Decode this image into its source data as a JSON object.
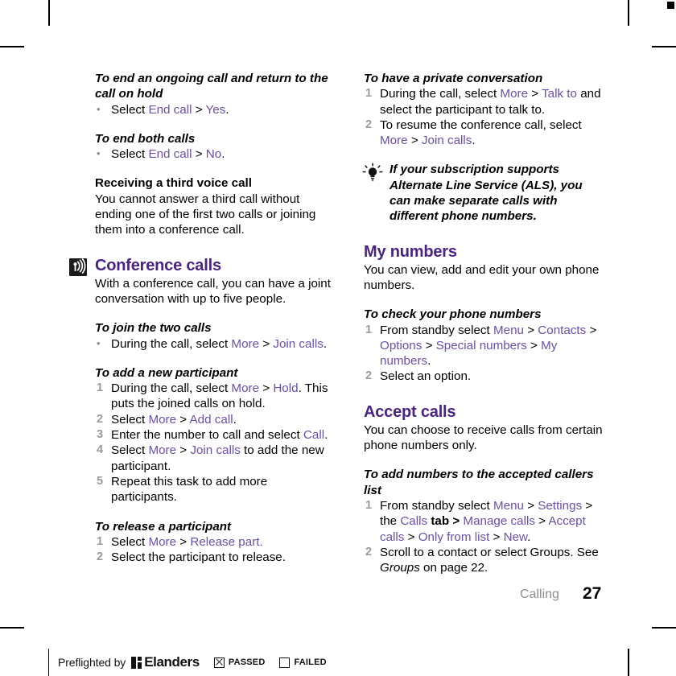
{
  "document": {
    "chapter": "Calling",
    "page_number": "27"
  },
  "left_column": {
    "block1": {
      "heading": "To end an ongoing call and return to the call on hold",
      "bullets": [
        {
          "pre": "Select ",
          "menu1": "End call",
          "sep": " > ",
          "menu2": "Yes",
          "post": "."
        }
      ]
    },
    "block2": {
      "heading": "To end both calls",
      "bullets": [
        {
          "pre": "Select ",
          "menu1": "End call",
          "sep": " > ",
          "menu2": "No",
          "post": "."
        }
      ]
    },
    "block3": {
      "heading": "Receiving a third voice call",
      "body": "You cannot answer a third call without ending one of the first two calls or joining them into a conference call."
    },
    "section": {
      "icon": "broadcast-icon",
      "title": "Conference calls",
      "intro": "With a conference call, you can have a joint conversation with up to five people."
    },
    "block4": {
      "heading": "To join the two calls",
      "bullets": [
        {
          "pre": "During the call, select ",
          "menu1": "More",
          "sep": " > ",
          "menu2": "Join calls",
          "post": "."
        }
      ]
    },
    "block5": {
      "heading": "To add a new participant",
      "steps": [
        {
          "pre": "During the call, select ",
          "menu1": "More",
          "sep": " > ",
          "menu2": "Hold",
          "post": ". This puts the joined calls on hold."
        },
        {
          "pre": "Select ",
          "menu1": "More",
          "sep": " > ",
          "menu2": "Add call",
          "post": "."
        },
        {
          "pre": "Enter the number to call and select ",
          "menu1": "Call",
          "sep": "",
          "menu2": "",
          "post": "."
        },
        {
          "pre": "Select ",
          "menu1": "More",
          "sep": " > ",
          "menu2": "Join calls",
          "post": " to add the new participant."
        },
        {
          "pre": "Repeat this task to add more participants.",
          "menu1": "",
          "sep": "",
          "menu2": "",
          "post": ""
        }
      ]
    },
    "block6": {
      "heading": "To release a participant",
      "steps": [
        {
          "pre": "Select ",
          "menu1": "More",
          "sep": " > ",
          "menu2": "Release part.",
          "post": ""
        },
        {
          "pre": "Select the participant to release.",
          "menu1": "",
          "sep": "",
          "menu2": "",
          "post": ""
        }
      ]
    }
  },
  "right_column": {
    "block1": {
      "heading": "To have a private conversation",
      "steps": [
        {
          "pre": "During the call, select ",
          "menu1": "More",
          "sep": " > ",
          "menu2": "Talk to",
          "post": " and select the participant to talk to."
        },
        {
          "pre": "To resume the conference call, select ",
          "menu1": "More",
          "sep": " > ",
          "menu2": "Join calls",
          "post": "."
        }
      ]
    },
    "tip": {
      "icon": "lightbulb-icon",
      "text": "If your subscription supports Alternate Line Service (ALS), you can make separate calls with different phone numbers."
    },
    "section_my_numbers": {
      "title": "My numbers",
      "intro": "You can view, add and edit your own phone numbers."
    },
    "block2": {
      "heading": "To check your phone numbers",
      "steps": [
        {
          "pre": "From standby select ",
          "menu1": "Menu",
          "sep": " > ",
          "menu2": "Contacts",
          "sep2": " > ",
          "menu3": "Options",
          "sep3": " > ",
          "menu4": "Special numbers",
          "sep4": " > ",
          "menu5": "My numbers",
          "post": "."
        },
        {
          "pre": "Select an option.",
          "menu1": "",
          "sep": "",
          "menu2": "",
          "post": ""
        }
      ]
    },
    "section_accept_calls": {
      "title": "Accept calls",
      "intro": "You can choose to receive calls from certain phone numbers only."
    },
    "block3": {
      "heading": "To add numbers to the accepted callers list",
      "steps": [
        {
          "pre": "From standby select ",
          "menu1": "Menu",
          "sep": " > ",
          "menu2": "Settings",
          "mid": " > the ",
          "menu3": "Calls",
          "mid2": " tab > ",
          "menu4": "Manage calls",
          "sep4": " > ",
          "menu5": "Accept calls",
          "sep5": " > ",
          "menu6": "Only from list",
          "sep6": " > ",
          "menu7": "New",
          "post": "."
        },
        {
          "pre": "Scroll to a contact or select Groups. See ",
          "italic": "Groups",
          "post": " on page 22."
        }
      ]
    }
  },
  "preflight": {
    "label": "Preflighted by",
    "brand": "Elanders",
    "passed": "PASSED",
    "failed": "FAILED",
    "passed_checked": true,
    "failed_checked": false
  },
  "colors": {
    "heading_purple": "#4a2482",
    "menu_purple": "#6b4fa8",
    "chapter_gray": "#8d8d8d",
    "list_number_gray": "#9a9a9a"
  }
}
